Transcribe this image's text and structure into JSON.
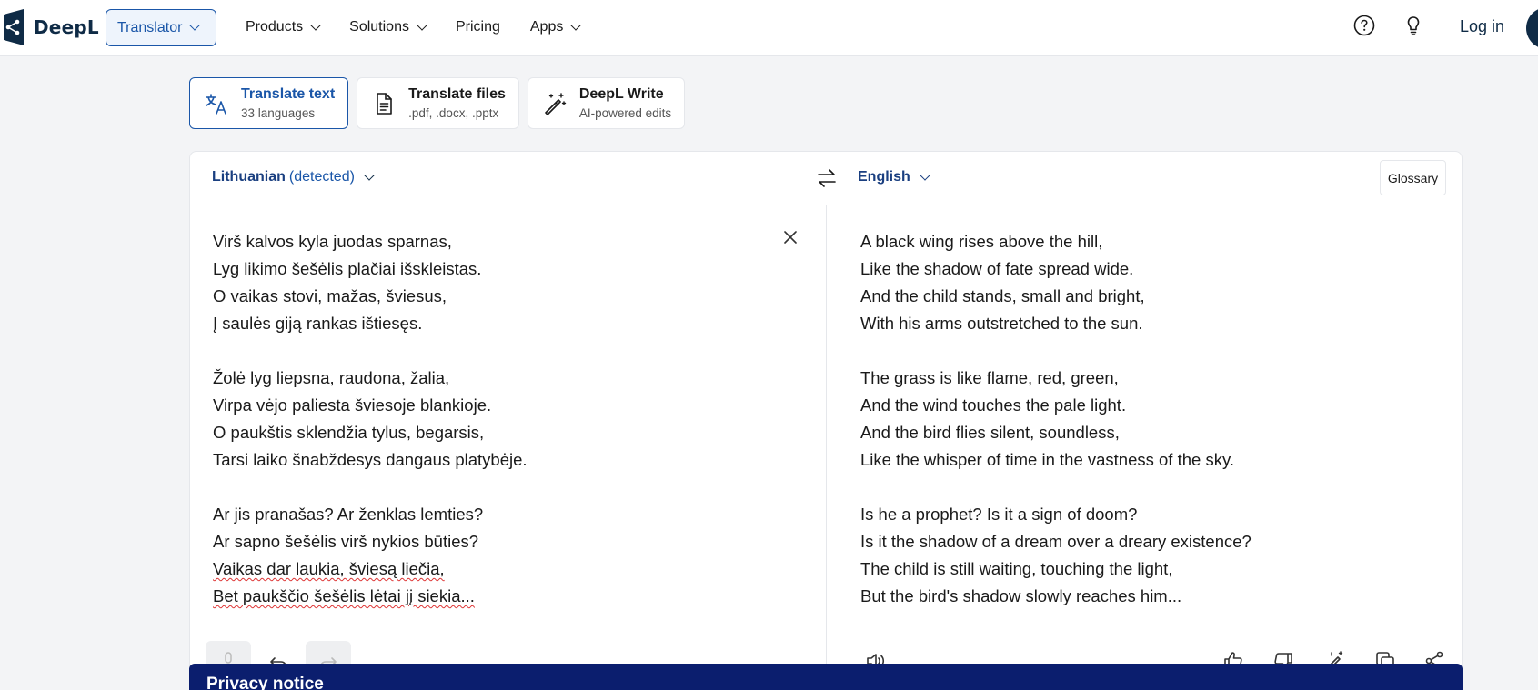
{
  "header": {
    "brand": "DeepL",
    "translator_label": "Translator",
    "nav": [
      {
        "label": "Products"
      },
      {
        "label": "Solutions"
      },
      {
        "label": "Pricing"
      },
      {
        "label": "Apps"
      }
    ],
    "login_label": "Log in",
    "icons": [
      "help-icon",
      "lightbulb-icon"
    ]
  },
  "modes": [
    {
      "title": "Translate text",
      "subtitle": "33 languages",
      "icon": "translate-icon"
    },
    {
      "title": "Translate files",
      "subtitle": ".pdf, .docx, .pptx",
      "icon": "document-icon"
    },
    {
      "title": "DeepL Write",
      "subtitle": "AI-powered edits",
      "icon": "magic-wand-icon"
    }
  ],
  "source": {
    "language": "Lithuanian",
    "detected": "(detected)",
    "lines": [
      "Virš kalvos kyla juodas sparnas,",
      "Lyg likimo šešėlis plačiai išskleistas.",
      "O vaikas stovi, mažas, šviesus,",
      "Į saulės giją rankas ištiesęs.",
      "",
      "Žolė lyg liepsna, raudona, žalia,",
      "Virpa vėjo paliesta šviesoje blankioje.",
      "O paukštis sklendžia tylus, begarsis,",
      "Tarsi laiko šnabždesys dangaus platybėje.",
      "",
      "Ar jis pranašas? Ar ženklas lemties?",
      "Ar sapno šešėlis virš nykios būties?",
      "Vaikas dar laukia, šviesą liečia,",
      "Bet paukščio šešėlis lėtai jį siekia..."
    ]
  },
  "target": {
    "language": "English",
    "glossary_label": "Glossary",
    "lines": [
      "A black wing rises above the hill,",
      "Like the shadow of fate spread wide.",
      "And the child stands, small and bright,",
      "With his arms outstretched to the sun.",
      "",
      "The grass is like flame, red, green,",
      "And the wind touches the pale light.",
      "And the bird flies silent, soundless,",
      "Like the whisper of time in the vastness of the sky.",
      "",
      "Is he a prophet? Is it a sign of doom?",
      "Is it the shadow of a dream over a dreary existence?",
      "The child is still waiting, touching the light,",
      "But the bird's shadow slowly reaches him..."
    ]
  },
  "privacy": {
    "title": "Privacy notice"
  },
  "colors": {
    "accent": "#1a56a8",
    "brand_dark": "#0f2b46",
    "privacy_banner": "#0b1e6e"
  }
}
